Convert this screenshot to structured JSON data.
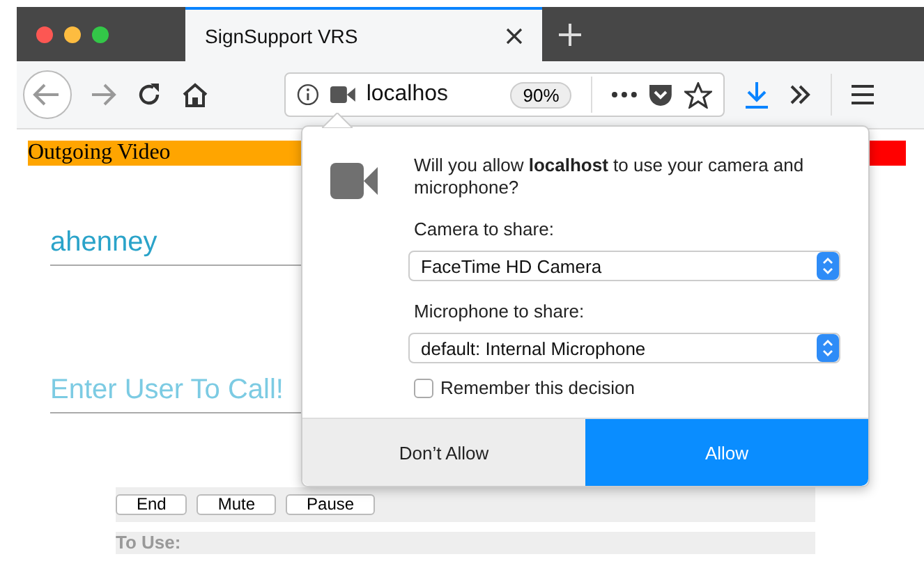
{
  "browser": {
    "tab": {
      "title": "SignSupport VRS",
      "selected": true
    },
    "address_bar": {
      "url": "localhos",
      "zoom": "90%"
    }
  },
  "page": {
    "outgoing_video": "Outgoing Video",
    "username": "ahenney",
    "call_field": {
      "placeholder": "Enter User To Call!"
    },
    "buttons": [
      "End",
      "Mute",
      "Pause"
    ],
    "section": "To Use:"
  },
  "permission_popup": {
    "message": "Will you allow **localhost** to use your camera and microphone?",
    "camera_label": "Camera to share:",
    "camera": "FaceTime HD Camera",
    "microphone_label": "Microphone to share:",
    "microphone": "default: Internal Microphone",
    "remember": {
      "label": "Remember this decision",
      "checked": false
    },
    "buttons": [
      {
        "label": "Don’t Allow",
        "kind": "secondary"
      },
      {
        "label": "Allow",
        "kind": "primary"
      }
    ]
  }
}
